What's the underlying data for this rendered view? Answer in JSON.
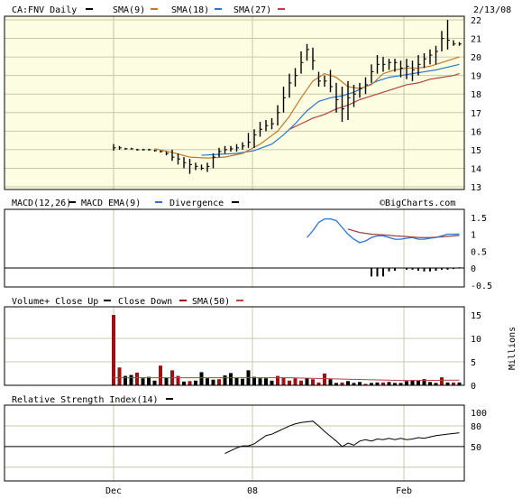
{
  "header": {
    "ticker_label": "CA:FNV Daily",
    "date": "2/13/08"
  },
  "legends": {
    "price": [
      {
        "label": "SMA(9)",
        "color": "#c07a2a"
      },
      {
        "label": "SMA(18)",
        "color": "#2a76d2"
      },
      {
        "label": "SMA(27)",
        "color": "#c44040"
      }
    ],
    "macd": [
      {
        "label": "MACD(12,26)",
        "color": "#000000"
      },
      {
        "label": "MACD EMA(9)",
        "color": "#2a76d2"
      },
      {
        "label": "Divergence",
        "color": "#b02020"
      }
    ],
    "volume": [
      {
        "label": "Volume+ Close Up",
        "color": "#000000"
      },
      {
        "label": "Close Down",
        "color": "#9b1010"
      },
      {
        "label": "SMA(50)",
        "color": "#c44040"
      }
    ],
    "rsi": [
      {
        "label": "Relative Strength Index(14)",
        "color": "#000000"
      }
    ],
    "watermark": "©BigCharts.com"
  },
  "colors": {
    "panel_bg": "#fdfde2",
    "grid": "#c8c8a8",
    "sma9": "#c07a2a",
    "sma18": "#2a76d2",
    "sma27": "#b84040",
    "down": "#9b1010",
    "macd": "#2a76d2",
    "signal": "#a04040"
  },
  "chart_data": [
    {
      "type": "ohlc",
      "panel": "price",
      "y_ticks": [
        22,
        21,
        20,
        19,
        18,
        17,
        16,
        15,
        14,
        13
      ],
      "ylim": [
        13,
        22
      ],
      "x_labels": [
        "Dec",
        "08",
        "Feb"
      ],
      "bars": [
        [
          15.3,
          14.95,
          15.1
        ],
        [
          15.2,
          15.0,
          15.1
        ],
        [
          15.1,
          15.0,
          15.05
        ],
        [
          15.1,
          15.0,
          15.05
        ],
        [
          15.05,
          14.95,
          15.0
        ],
        [
          15.05,
          14.95,
          15.0
        ],
        [
          15.05,
          14.95,
          15.0
        ],
        [
          15.0,
          14.9,
          14.95
        ],
        [
          14.95,
          14.85,
          14.9
        ],
        [
          14.9,
          14.7,
          14.8
        ],
        [
          15.0,
          14.4,
          14.6
        ],
        [
          14.8,
          14.2,
          14.5
        ],
        [
          14.6,
          14.0,
          14.3
        ],
        [
          14.5,
          13.7,
          14.2
        ],
        [
          14.3,
          13.9,
          14.1
        ],
        [
          14.2,
          13.9,
          14.0
        ],
        [
          14.3,
          13.8,
          14.1
        ],
        [
          14.8,
          14.0,
          14.6
        ],
        [
          15.1,
          14.6,
          14.9
        ],
        [
          15.2,
          14.8,
          15.0
        ],
        [
          15.2,
          14.9,
          15.05
        ],
        [
          15.3,
          14.9,
          15.1
        ],
        [
          15.4,
          15.0,
          15.2
        ],
        [
          15.9,
          15.1,
          15.4
        ],
        [
          16.1,
          15.1,
          15.8
        ],
        [
          16.5,
          15.7,
          16.1
        ],
        [
          16.6,
          16.0,
          16.3
        ],
        [
          16.7,
          16.1,
          16.4
        ],
        [
          17.4,
          16.3,
          17.0
        ],
        [
          18.4,
          17.0,
          17.8
        ],
        [
          19.1,
          17.8,
          18.6
        ],
        [
          19.4,
          18.4,
          19.0
        ],
        [
          20.3,
          19.1,
          19.7
        ],
        [
          20.7,
          19.8,
          20.4
        ],
        [
          20.5,
          19.3,
          19.8
        ],
        [
          19.2,
          18.4,
          18.7
        ],
        [
          19.0,
          18.4,
          18.7
        ],
        [
          19.3,
          18.1,
          18.4
        ],
        [
          18.6,
          17.0,
          17.7
        ],
        [
          18.4,
          16.5,
          17.2
        ],
        [
          18.7,
          16.6,
          17.8
        ],
        [
          18.5,
          17.3,
          18.0
        ],
        [
          18.6,
          17.8,
          18.3
        ],
        [
          18.9,
          18.0,
          18.5
        ],
        [
          19.6,
          18.6,
          19.2
        ],
        [
          20.1,
          19.1,
          19.6
        ],
        [
          20.0,
          19.2,
          19.6
        ],
        [
          19.9,
          19.3,
          19.7
        ],
        [
          19.9,
          19.2,
          19.7
        ],
        [
          19.8,
          18.9,
          19.4
        ],
        [
          19.9,
          18.8,
          19.5
        ],
        [
          19.8,
          18.7,
          19.3
        ],
        [
          20.1,
          19.0,
          19.6
        ],
        [
          20.2,
          19.4,
          19.9
        ],
        [
          20.4,
          19.6,
          20.1
        ],
        [
          20.6,
          19.6,
          20.3
        ],
        [
          21.4,
          20.3,
          21.0
        ],
        [
          22.0,
          20.4,
          20.9
        ],
        [
          20.9,
          20.6,
          20.7
        ],
        [
          20.8,
          20.6,
          20.7
        ]
      ],
      "sma9": [
        [
          7,
          15.05
        ],
        [
          10,
          14.85
        ],
        [
          13,
          14.6
        ],
        [
          16,
          14.55
        ],
        [
          19,
          14.6
        ],
        [
          22,
          14.8
        ],
        [
          25,
          15.3
        ],
        [
          28,
          16.0
        ],
        [
          30,
          16.8
        ],
        [
          32,
          17.8
        ],
        [
          34,
          18.7
        ],
        [
          36,
          19.1
        ],
        [
          38,
          18.9
        ],
        [
          40,
          18.4
        ],
        [
          42,
          18.3
        ],
        [
          44,
          18.5
        ],
        [
          46,
          19.1
        ],
        [
          48,
          19.3
        ],
        [
          50,
          19.4
        ],
        [
          52,
          19.4
        ],
        [
          54,
          19.5
        ],
        [
          56,
          19.7
        ],
        [
          59,
          20.0
        ]
      ],
      "sma18": [
        [
          15,
          14.7
        ],
        [
          18,
          14.75
        ],
        [
          21,
          14.8
        ],
        [
          24,
          14.95
        ],
        [
          27,
          15.3
        ],
        [
          29,
          15.8
        ],
        [
          31,
          16.4
        ],
        [
          33,
          17.1
        ],
        [
          35,
          17.6
        ],
        [
          37,
          17.8
        ],
        [
          39,
          17.9
        ],
        [
          41,
          18.1
        ],
        [
          43,
          18.4
        ],
        [
          45,
          18.7
        ],
        [
          47,
          18.9
        ],
        [
          49,
          19.0
        ],
        [
          51,
          19.1
        ],
        [
          53,
          19.2
        ],
        [
          55,
          19.3
        ],
        [
          57,
          19.45
        ],
        [
          59,
          19.6
        ]
      ],
      "sma27": [
        [
          30,
          16.1
        ],
        [
          32,
          16.4
        ],
        [
          34,
          16.7
        ],
        [
          36,
          16.9
        ],
        [
          38,
          17.2
        ],
        [
          40,
          17.4
        ],
        [
          42,
          17.7
        ],
        [
          44,
          17.9
        ],
        [
          46,
          18.1
        ],
        [
          48,
          18.3
        ],
        [
          50,
          18.5
        ],
        [
          52,
          18.6
        ],
        [
          54,
          18.8
        ],
        [
          56,
          18.9
        ],
        [
          58,
          19.0
        ],
        [
          59,
          19.1
        ]
      ]
    },
    {
      "type": "line",
      "panel": "macd",
      "y_ticks": [
        1.5,
        1.0,
        0.5,
        0.0,
        -0.5
      ],
      "ylim": [
        -0.5,
        1.5
      ],
      "series": [
        {
          "values": [
            [
              33,
              0.9
            ],
            [
              34,
              1.1
            ],
            [
              35,
              1.35
            ],
            [
              36,
              1.45
            ],
            [
              37,
              1.45
            ],
            [
              38,
              1.4
            ],
            [
              39,
              1.2
            ],
            [
              40,
              1.0
            ],
            [
              41,
              0.85
            ],
            [
              42,
              0.75
            ],
            [
              43,
              0.8
            ],
            [
              44,
              0.9
            ],
            [
              45,
              0.95
            ],
            [
              46,
              0.95
            ],
            [
              47,
              0.9
            ],
            [
              48,
              0.85
            ],
            [
              49,
              0.85
            ],
            [
              50,
              0.88
            ],
            [
              51,
              0.9
            ],
            [
              52,
              0.85
            ],
            [
              53,
              0.85
            ],
            [
              54,
              0.88
            ],
            [
              55,
              0.9
            ],
            [
              56,
              0.95
            ],
            [
              57,
              1.0
            ],
            [
              58,
              1.0
            ],
            [
              59,
              1.0
            ]
          ]
        },
        {
          "values": [
            [
              40,
              1.15
            ],
            [
              42,
              1.05
            ],
            [
              44,
              1.0
            ],
            [
              46,
              0.98
            ],
            [
              48,
              0.95
            ],
            [
              50,
              0.93
            ],
            [
              52,
              0.9
            ],
            [
              54,
              0.9
            ],
            [
              56,
              0.92
            ],
            [
              58,
              0.95
            ],
            [
              59,
              0.96
            ]
          ]
        }
      ],
      "divergence": [
        [
          44,
          -0.25
        ],
        [
          45,
          -0.25
        ],
        [
          46,
          -0.25
        ],
        [
          47,
          -0.1
        ],
        [
          48,
          -0.08
        ],
        [
          50,
          -0.05
        ],
        [
          51,
          -0.05
        ],
        [
          52,
          -0.08
        ],
        [
          53,
          -0.1
        ],
        [
          54,
          -0.1
        ],
        [
          55,
          -0.08
        ],
        [
          56,
          -0.05
        ],
        [
          57,
          -0.05
        ],
        [
          58,
          -0.03
        ],
        [
          59,
          0.02
        ]
      ]
    },
    {
      "type": "bar",
      "panel": "volume",
      "ylabel": "Millions",
      "y_ticks": [
        15,
        10,
        5,
        0
      ],
      "ylim": [
        0,
        15
      ],
      "volumes": [
        [
          15.0,
          "down"
        ],
        [
          3.8,
          "down"
        ],
        [
          2.0,
          "up"
        ],
        [
          2.2,
          "up"
        ],
        [
          2.7,
          "down"
        ],
        [
          1.5,
          "up"
        ],
        [
          1.8,
          "up"
        ],
        [
          1.0,
          "up"
        ],
        [
          4.2,
          "down"
        ],
        [
          1.6,
          "up"
        ],
        [
          3.2,
          "down"
        ],
        [
          2.0,
          "down"
        ],
        [
          0.8,
          "up"
        ],
        [
          0.9,
          "down"
        ],
        [
          1.0,
          "up"
        ],
        [
          2.8,
          "up"
        ],
        [
          1.5,
          "up"
        ],
        [
          1.2,
          "up"
        ],
        [
          1.3,
          "down"
        ],
        [
          2.1,
          "up"
        ],
        [
          2.6,
          "up"
        ],
        [
          1.6,
          "up"
        ],
        [
          1.4,
          "up"
        ],
        [
          3.2,
          "up"
        ],
        [
          1.8,
          "up"
        ],
        [
          1.5,
          "up"
        ],
        [
          1.5,
          "up"
        ],
        [
          1.0,
          "up"
        ],
        [
          2.0,
          "down"
        ],
        [
          1.6,
          "down"
        ],
        [
          1.0,
          "down"
        ],
        [
          1.5,
          "down"
        ],
        [
          1.0,
          "down"
        ],
        [
          1.5,
          "up"
        ],
        [
          1.3,
          "down"
        ],
        [
          0.6,
          "down"
        ],
        [
          2.5,
          "down"
        ],
        [
          1.3,
          "up"
        ],
        [
          0.5,
          "up"
        ],
        [
          0.6,
          "down"
        ],
        [
          0.9,
          "up"
        ],
        [
          0.5,
          "up"
        ],
        [
          0.7,
          "up"
        ],
        [
          0.3,
          "down"
        ],
        [
          0.5,
          "up"
        ],
        [
          0.6,
          "up"
        ],
        [
          0.6,
          "down"
        ],
        [
          0.7,
          "up"
        ],
        [
          0.5,
          "up"
        ],
        [
          0.5,
          "up"
        ],
        [
          0.9,
          "up"
        ],
        [
          1.1,
          "up"
        ],
        [
          1.0,
          "up"
        ],
        [
          1.3,
          "up"
        ],
        [
          0.7,
          "up"
        ],
        [
          0.5,
          "up"
        ],
        [
          1.7,
          "down"
        ],
        [
          0.6,
          "up"
        ],
        [
          0.6,
          "down"
        ],
        [
          0.6,
          "up"
        ]
      ],
      "sma50": [
        [
          0,
          1.6
        ],
        [
          10,
          1.6
        ],
        [
          20,
          1.6
        ],
        [
          30,
          1.6
        ],
        [
          40,
          1.3
        ],
        [
          50,
          1.0
        ],
        [
          59,
          1.1
        ]
      ]
    },
    {
      "type": "line",
      "panel": "rsi",
      "y_ticks": [
        100,
        80,
        50,
        20,
        0
      ],
      "ylim": [
        0,
        100
      ],
      "reference_lines": [
        50
      ],
      "series": [
        {
          "values": [
            [
              19,
              40
            ],
            [
              20,
              44
            ],
            [
              21,
              48
            ],
            [
              22,
              51
            ],
            [
              23,
              51
            ],
            [
              24,
              54
            ],
            [
              25,
              60
            ],
            [
              26,
              66
            ],
            [
              27,
              68
            ],
            [
              28,
              72
            ],
            [
              29,
              76
            ],
            [
              30,
              80
            ],
            [
              31,
              83
            ],
            [
              32,
              85
            ],
            [
              33,
              86
            ],
            [
              34,
              87
            ],
            [
              35,
              80
            ],
            [
              36,
              72
            ],
            [
              37,
              65
            ],
            [
              38,
              58
            ],
            [
              39,
              50
            ],
            [
              40,
              55
            ],
            [
              41,
              52
            ],
            [
              42,
              58
            ],
            [
              43,
              60
            ],
            [
              44,
              58
            ],
            [
              45,
              61
            ],
            [
              46,
              60
            ],
            [
              47,
              62
            ],
            [
              48,
              60
            ],
            [
              49,
              62
            ],
            [
              50,
              60
            ],
            [
              51,
              61
            ],
            [
              52,
              63
            ],
            [
              53,
              62
            ],
            [
              54,
              64
            ],
            [
              55,
              66
            ],
            [
              56,
              67
            ],
            [
              57,
              68
            ],
            [
              58,
              69
            ],
            [
              59,
              70
            ]
          ]
        }
      ]
    }
  ]
}
